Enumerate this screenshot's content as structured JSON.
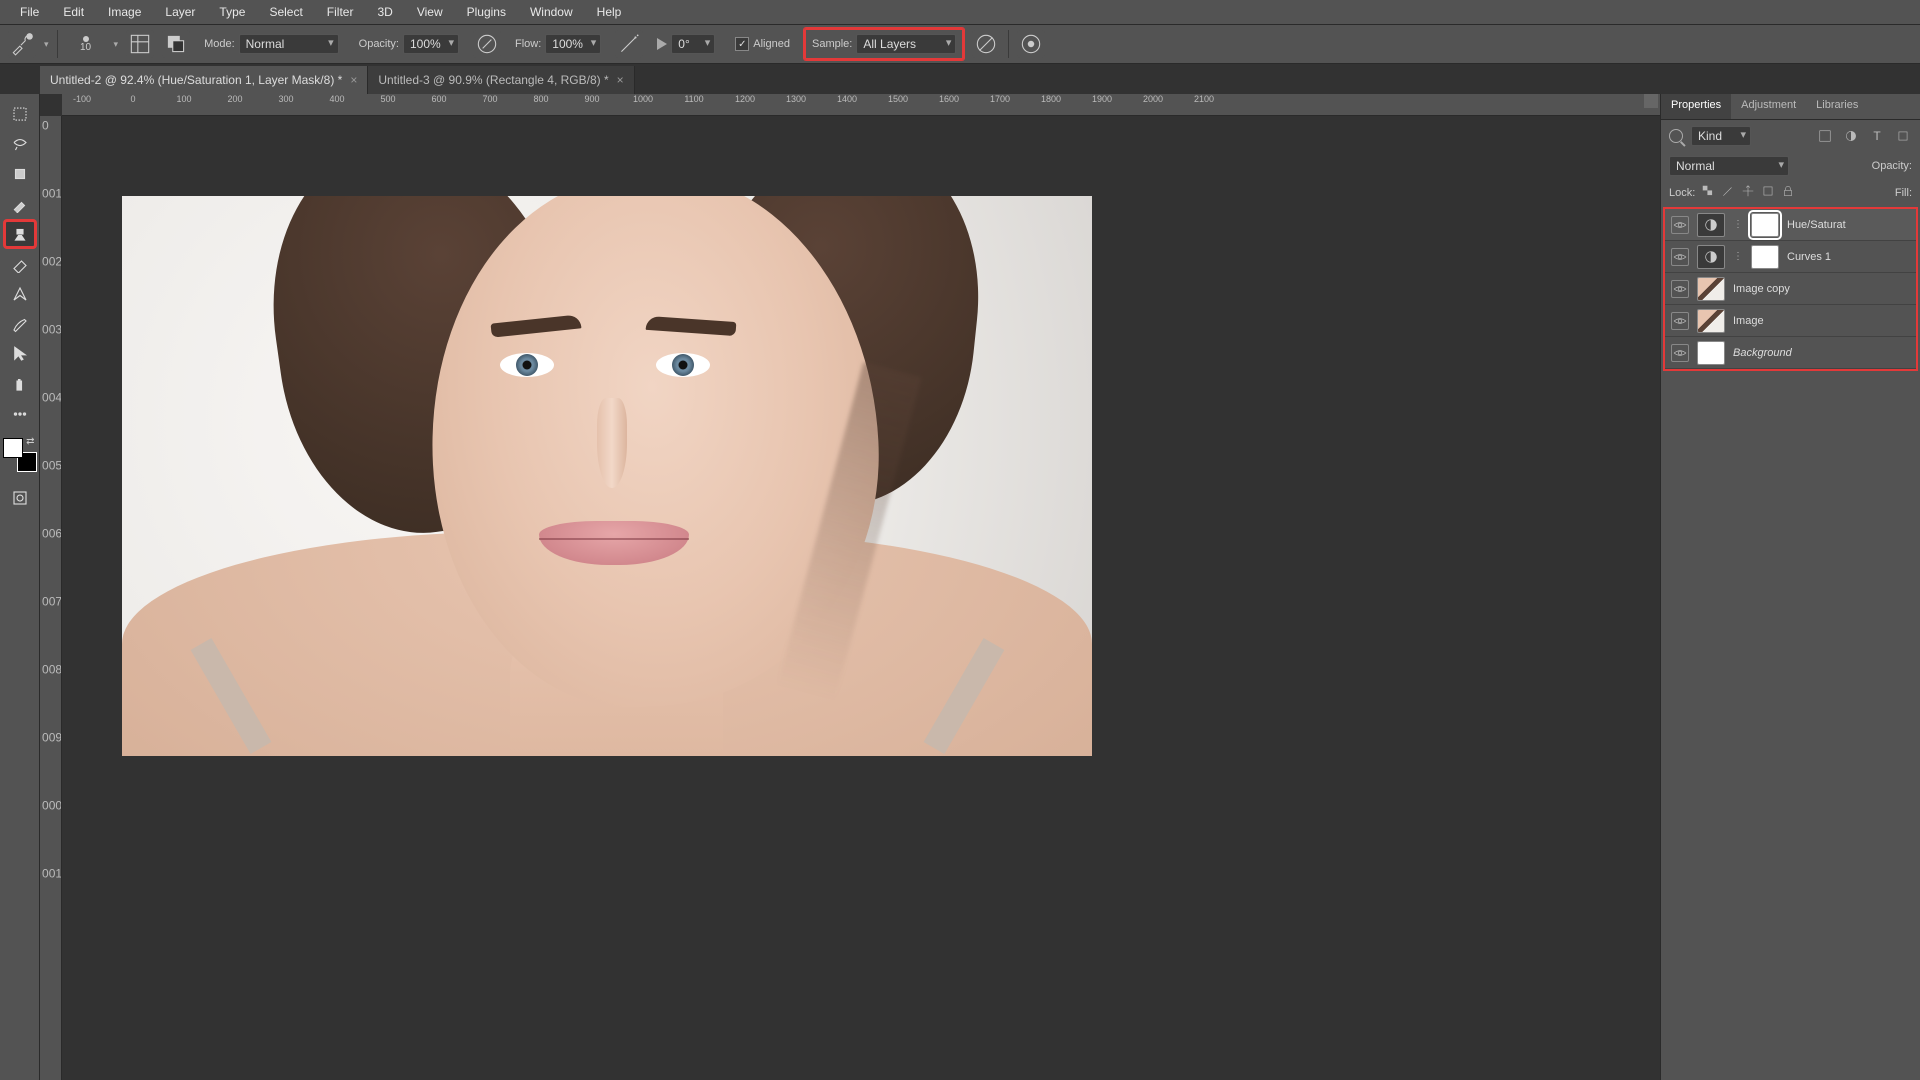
{
  "menu": [
    "File",
    "Edit",
    "Image",
    "Layer",
    "Type",
    "Select",
    "Filter",
    "3D",
    "View",
    "Plugins",
    "Window",
    "Help"
  ],
  "options": {
    "brush_size": "10",
    "mode_label": "Mode:",
    "mode": "Normal",
    "opacity_label": "Opacity:",
    "opacity": "100%",
    "flow_label": "Flow:",
    "flow": "100%",
    "angle": "0°",
    "aligned_label": "Aligned",
    "sample_label": "Sample:",
    "sample": "All Layers"
  },
  "tabs": [
    {
      "title": "Untitled-2 @ 92.4% (Hue/Saturation 1, Layer Mask/8) *",
      "active": true
    },
    {
      "title": "Untitled-3 @ 90.9% (Rectangle 4, RGB/8) *",
      "active": false
    }
  ],
  "ruler_h": [
    "-100",
    "0",
    "100",
    "200",
    "300",
    "400",
    "500",
    "600",
    "700",
    "800",
    "900",
    "1000",
    "1100",
    "1200",
    "1300",
    "1400",
    "1500",
    "1600",
    "1700",
    "1800",
    "1900",
    "2000",
    "2100"
  ],
  "ruler_v": [
    "0",
    "100",
    "200",
    "300",
    "400",
    "500",
    "600",
    "700",
    "800",
    "900",
    "1000",
    "1100"
  ],
  "panels": {
    "tabs": [
      "Properties",
      "Adjustment",
      "Libraries"
    ],
    "filter_kind": "Kind",
    "blend_mode": "Normal",
    "opacity_label": "Opacity:",
    "lock_label": "Lock:",
    "fill_label": "Fill:"
  },
  "layers": [
    {
      "name": "Hue/Saturat",
      "type": "adjustment",
      "selected": true,
      "mask_selected": true
    },
    {
      "name": "Curves 1",
      "type": "adjustment",
      "selected": false
    },
    {
      "name": "Image copy",
      "type": "image",
      "selected": false
    },
    {
      "name": "Image",
      "type": "image",
      "selected": false
    },
    {
      "name": "Background",
      "type": "solid",
      "selected": false,
      "italic": true
    }
  ]
}
